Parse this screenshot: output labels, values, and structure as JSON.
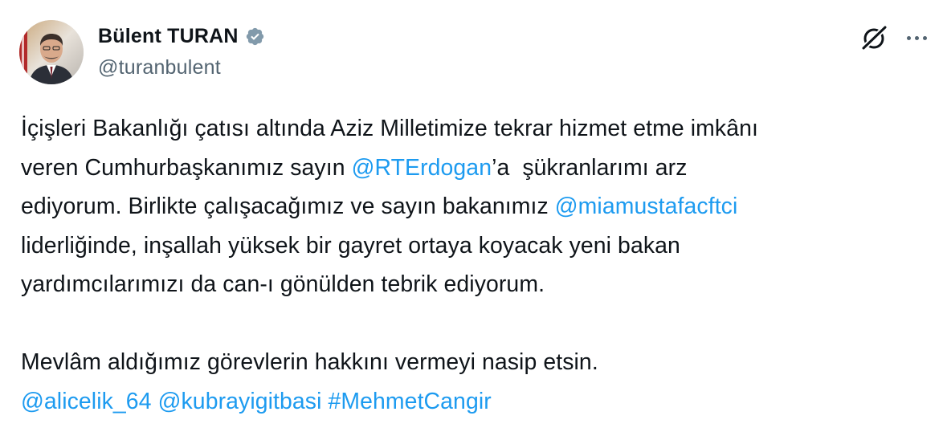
{
  "author": {
    "display_name": "Bülent TURAN",
    "handle": "@turanbulent",
    "avatar_alt": "profile photo"
  },
  "icons": {
    "verified": "verified-badge-icon",
    "grok": "grok-icon",
    "more": "more-options-icon"
  },
  "colors": {
    "link": "#1d9bf0",
    "text": "#0f1419",
    "secondary": "#536471"
  },
  "tweet": {
    "line1": "İçişleri Bakanlığı çatısı altında Aziz Milletimize tekrar hizmet etme imkânı",
    "line2_pre": "veren Cumhurbaşkanımız sayın ",
    "mention_rte": "@RTErdogan",
    "line2_post": "’a  şükranlarımı arz",
    "line3_pre": "ediyorum. Birlikte çalışacağımız ve sayın bakanımız ",
    "mention_mia": "@miamustafacftci",
    "line4": "liderliğinde, inşallah yüksek bir gayret ortaya koyacak yeni bakan",
    "line5": "yardımcılarımızı da can-ı gönülden tebrik ediyorum.",
    "line6": "Mevlâm aldığımız görevlerin hakkını vermeyi nasip etsin.",
    "mention_ali": "@alicelik_64",
    "mention_kubra": "@kubrayigitbasi",
    "hashtag": "#MehmetCangir"
  }
}
